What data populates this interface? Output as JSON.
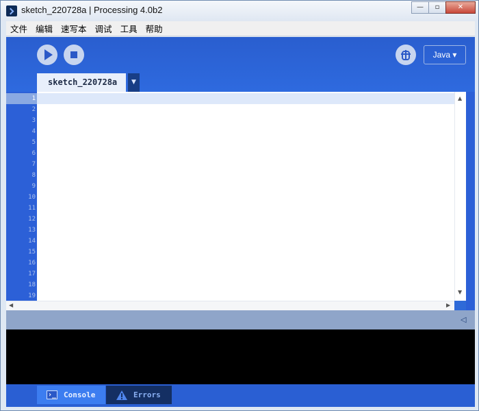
{
  "window": {
    "title": "sketch_220728a | Processing 4.0b2",
    "controls": {
      "minimize": "—",
      "maximize": "▫",
      "close": "✕"
    }
  },
  "menu": [
    "文件",
    "编辑",
    "速写本",
    "调试",
    "工具",
    "帮助"
  ],
  "toolbar": {
    "mode_label": "Java ▾",
    "icons": [
      "play-icon",
      "stop-icon",
      "debug-icon"
    ]
  },
  "editor": {
    "tab_name": "sketch_220728a",
    "tab_menu": "▼",
    "line_numbers": [
      "1",
      "2",
      "3",
      "4",
      "5",
      "6",
      "7",
      "8",
      "9",
      "10",
      "11",
      "12",
      "13",
      "14",
      "15",
      "16",
      "17",
      "18",
      "19"
    ],
    "active_line": "1"
  },
  "console": {
    "collapse_symbol": "◁"
  },
  "bottom_tabs": {
    "console_label": "Console",
    "errors_label": "Errors"
  },
  "colors": {
    "accent": "#2f6ad8",
    "console_bg": "#000000",
    "gutter": "#2c60d7"
  }
}
